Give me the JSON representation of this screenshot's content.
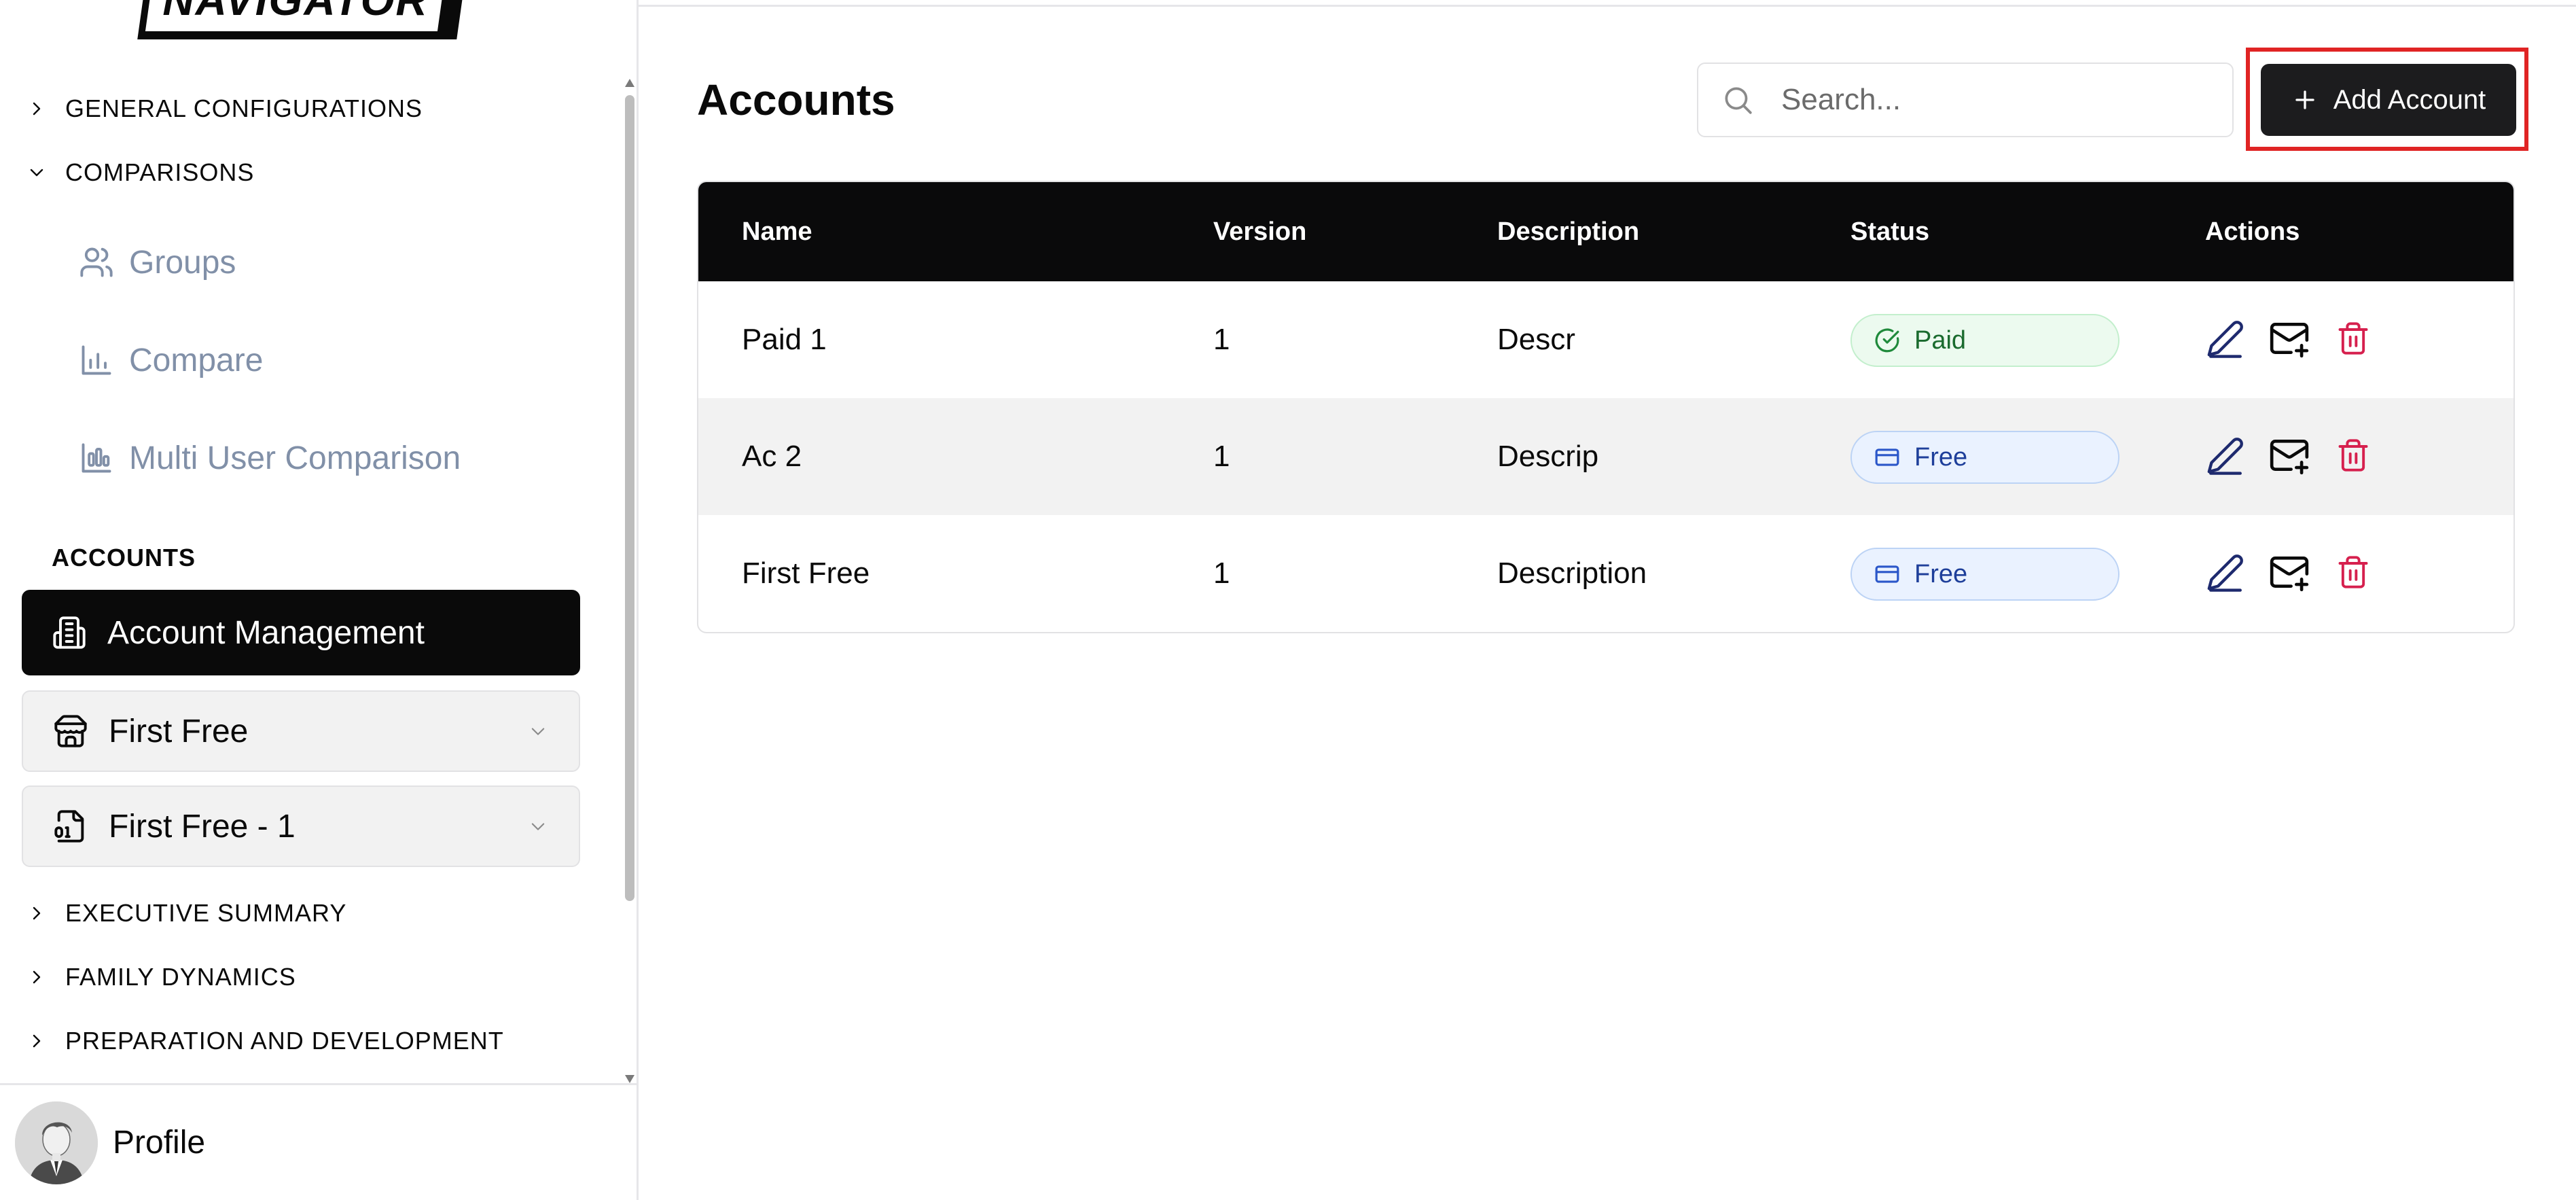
{
  "sidebar": {
    "logo_text": "NAVIGATOR",
    "sections_top": [
      {
        "label": "GENERAL CONFIGURATIONS",
        "expanded": false
      },
      {
        "label": "COMPARISONS",
        "expanded": true
      }
    ],
    "comparison_items": [
      {
        "label": "Groups",
        "icon": "users-icon"
      },
      {
        "label": "Compare",
        "icon": "bar-chart-icon"
      },
      {
        "label": "Multi User Comparison",
        "icon": "grouped-bar-chart-icon"
      }
    ],
    "accounts_heading": "ACCOUNTS",
    "account_management": {
      "label": "Account Management",
      "icon": "building-icon"
    },
    "account_select": {
      "value": "First Free",
      "icon": "store-icon"
    },
    "version_select": {
      "value": "First Free - 1",
      "icon": "file-binary-icon"
    },
    "sections_bottom": [
      {
        "label": "EXECUTIVE SUMMARY",
        "expanded": false
      },
      {
        "label": "FAMILY DYNAMICS",
        "expanded": false
      },
      {
        "label": "PREPARATION AND DEVELOPMENT",
        "expanded": false
      }
    ],
    "profile": {
      "label": "Profile"
    }
  },
  "main": {
    "title": "Accounts",
    "search": {
      "placeholder": "Search...",
      "value": ""
    },
    "add_button": {
      "label": "Add Account"
    },
    "table": {
      "columns": [
        "Name",
        "Version",
        "Description",
        "Status",
        "Actions"
      ],
      "rows": [
        {
          "name": "Paid 1",
          "version": "1",
          "description": "Descr",
          "status": "Paid",
          "status_type": "paid"
        },
        {
          "name": "Ac 2",
          "version": "1",
          "description": "Descrip",
          "status": "Free",
          "status_type": "free"
        },
        {
          "name": "First Free",
          "version": "1",
          "description": "Description",
          "status": "Free",
          "status_type": "free"
        }
      ]
    }
  },
  "colors": {
    "accent_dark": "#0a0a0a",
    "muted_nav": "#8190a8",
    "paid_text": "#1a6b2e",
    "free_text": "#1e3f9a",
    "delete_red": "#d6204e",
    "edit_navy": "#1e2a6e",
    "highlight_red": "#e02424"
  }
}
